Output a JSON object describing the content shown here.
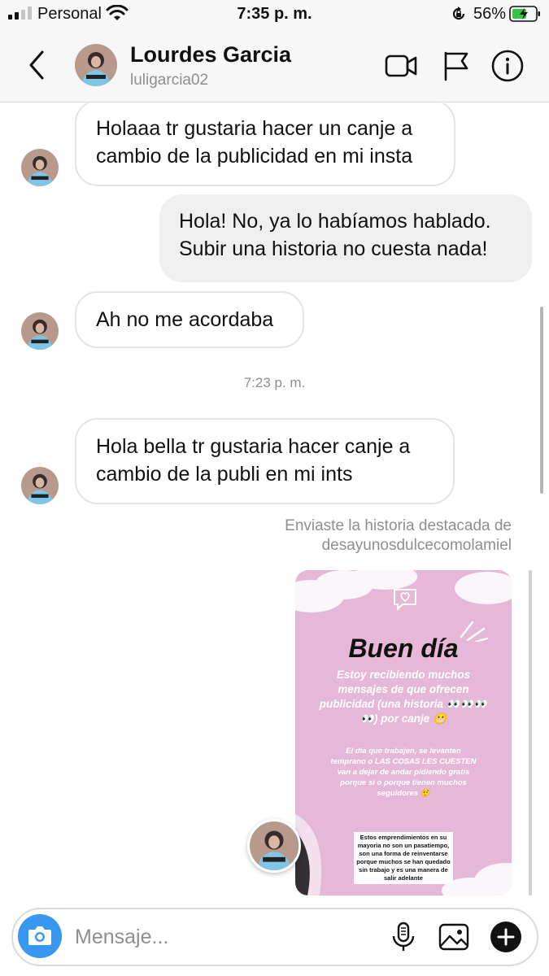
{
  "status_bar": {
    "carrier": "Personal",
    "time": "7:35 p. m.",
    "battery": "56%"
  },
  "header": {
    "name": "Lourdes Garcia",
    "username": "luligarcia02",
    "icons": [
      "back-chevron-icon",
      "video-call-icon",
      "flag-icon",
      "info-icon"
    ]
  },
  "messages": [
    {
      "from": "them",
      "text_1": "Holaaa tr gustaria hacer un canje a",
      "text_2": "cambio de la publicidad en mi insta"
    },
    {
      "from": "me",
      "text_1": "Hola! No, ya lo habíamos hablado.",
      "text_2": "Subir una historia no cuesta nada!"
    },
    {
      "from": "them",
      "text_1": "Ah no me acordaba"
    },
    {
      "from": "them",
      "text_1": "Hola bella tr gustaria hacer canje a",
      "text_2": "cambio de la publi en mi ints"
    }
  ],
  "timestamp": "7:23 p. m.",
  "story_note": {
    "line_1": "Enviaste la historia destacada de",
    "line_2": "desayunosdulcecomolamiel"
  },
  "story": {
    "title": "Buen día",
    "paragraph_1": "Estoy recibiendo muchos mensajes de que ofrecen publicidad (una historia 👀👀👀👀) por canje 😬",
    "paragraph_2": "El día que trabajen, se levanten temprano o LAS COSAS LES CUESTEN van a dejar de andar pidiendo gratis porque sí o porque tienen muchos seguidores 🤨",
    "paragraph_3": "Estos emprendimientos en su mayoria no son un pasatiempo, son una forma de reinventarse porque muchos se han quedado sin trabajo y es una manera de salir adelante",
    "background": "#e6b8d8"
  },
  "composer": {
    "placeholder": "Mensaje...",
    "value": ""
  },
  "colors": {
    "accent": "#3897f0",
    "bubble_out": "#efefef",
    "muted_text": "#8e8e8e"
  }
}
